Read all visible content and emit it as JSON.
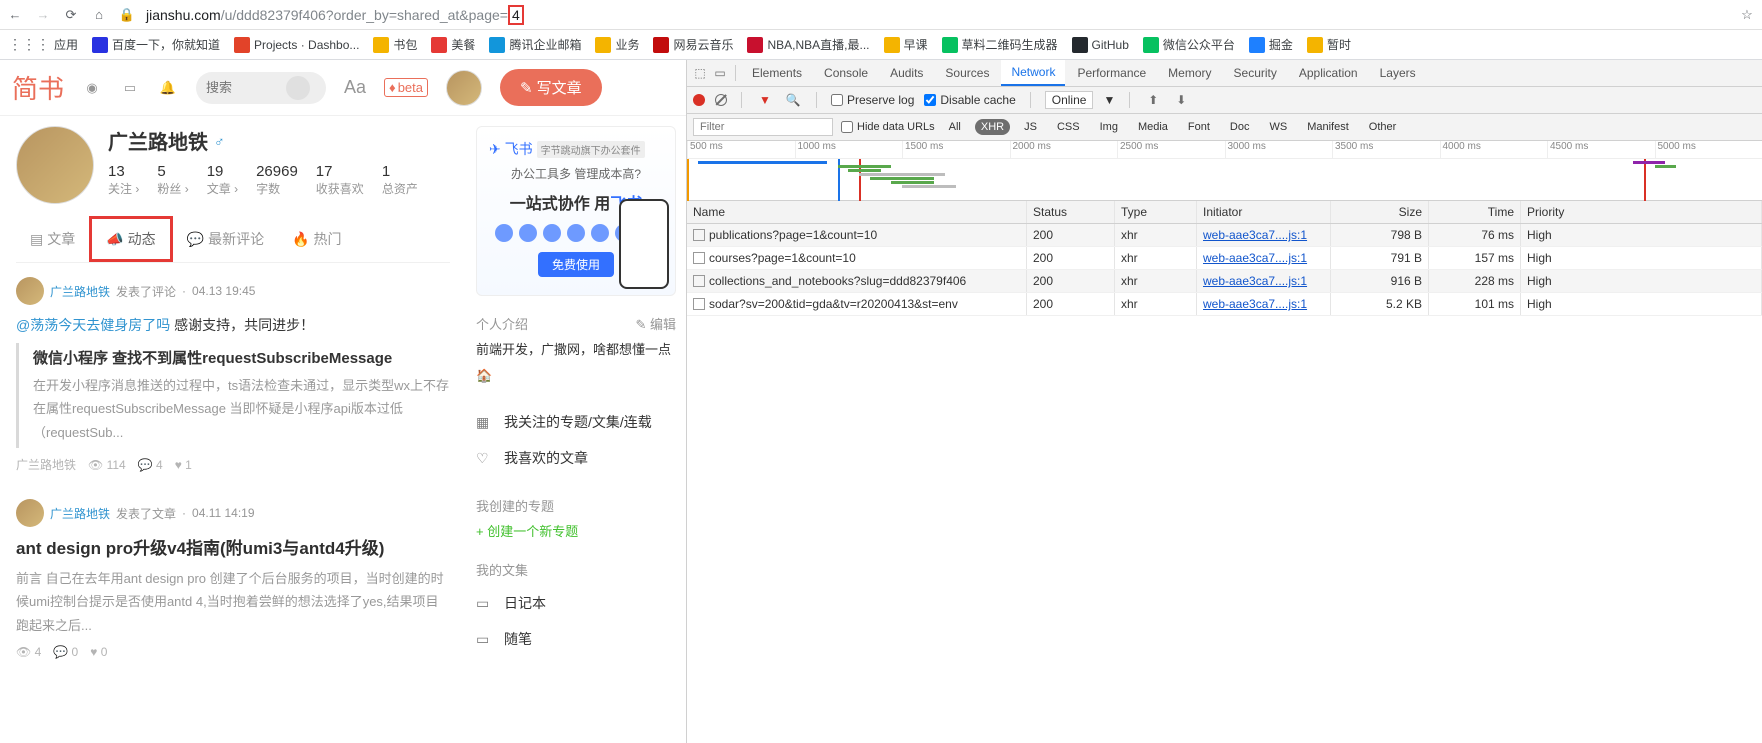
{
  "browser": {
    "url_host": "jianshu.com",
    "url_path": "/u/ddd82379f406?order_by=shared_at&page=",
    "url_highlight": "4"
  },
  "bookmarks": [
    {
      "label": "应用",
      "color": "#5f6368"
    },
    {
      "label": "百度一下，你就知道",
      "color": "#2932e1"
    },
    {
      "label": "Projects · Dashbo...",
      "color": "#e24329"
    },
    {
      "label": "书包",
      "color": "#f4b400"
    },
    {
      "label": "美餐",
      "color": "#e53935"
    },
    {
      "label": "腾讯企业邮箱",
      "color": "#1296db"
    },
    {
      "label": "业务",
      "color": "#f4b400"
    },
    {
      "label": "网易云音乐",
      "color": "#c20c0c"
    },
    {
      "label": "NBA,NBA直播,最...",
      "color": "#c8102e"
    },
    {
      "label": "早课",
      "color": "#f4b400"
    },
    {
      "label": "草料二维码生成器",
      "color": "#07c160"
    },
    {
      "label": "GitHub",
      "color": "#24292e"
    },
    {
      "label": "微信公众平台",
      "color": "#07c160"
    },
    {
      "label": "掘金",
      "color": "#1e80ff"
    },
    {
      "label": "暂时",
      "color": "#f4b400"
    }
  ],
  "jianshu": {
    "logo": "简书",
    "search_placeholder": "搜索",
    "write_label": "写文章",
    "beta": "beta",
    "profile": {
      "name": "广兰路地铁",
      "stats": [
        {
          "num": "13",
          "label": "关注"
        },
        {
          "num": "5",
          "label": "粉丝"
        },
        {
          "num": "19",
          "label": "文章"
        },
        {
          "num": "26969",
          "label": "字数"
        },
        {
          "num": "17",
          "label": "收获喜欢"
        },
        {
          "num": "1",
          "label": "总资产"
        }
      ]
    },
    "tabs": [
      {
        "label": "文章"
      },
      {
        "label": "动态"
      },
      {
        "label": "最新评论"
      },
      {
        "label": "热门"
      }
    ],
    "feed": [
      {
        "author": "广兰路地铁",
        "action": "发表了评论",
        "time": "04.13 19:45",
        "comment_at": "@荡荡今天去健身房了吗",
        "comment_text": " 感谢支持，共同进步！",
        "quote_title": "微信小程序 查找不到属性requestSubscribeMessage",
        "quote_desc": "在开发小程序消息推送的过程中，ts语法检查未通过，显示类型wx上不存在属性requestSubscribeMessage 当即怀疑是小程序api版本过低（requestSub...",
        "meta_author": "广兰路地铁",
        "views": "114",
        "comments": "4",
        "likes": "1"
      },
      {
        "author": "广兰路地铁",
        "action": "发表了文章",
        "time": "04.11 14:19",
        "title": "ant design pro升级v4指南(附umi3与antd4升级)",
        "desc": "前言 自己在去年用ant design pro 创建了个后台服务的项目，当时创建的时候umi控制台提示是否使用antd 4,当时抱着尝鲜的想法选择了yes,结果项目跑起来之后...",
        "views": "4",
        "comments": "0",
        "likes": "0"
      }
    ],
    "sidebar": {
      "ad_small": "办公工具多 管理成本高?",
      "ad_title_1": "一站式协作 用",
      "ad_title_2": "飞书",
      "ad_free": "免费使用",
      "intro_head": "个人介绍",
      "intro_edit": "编辑",
      "intro_text": "前端开发，广撒网，啥都想懂一点",
      "follow_label": "我关注的专题/文集/连载",
      "like_label": "我喜欢的文章",
      "create_head": "我创建的专题",
      "create_add": "+ 创建一个新专题",
      "wenji_head": "我的文集",
      "wenji_items": [
        "日记本",
        "随笔"
      ]
    }
  },
  "devtools": {
    "tabs": [
      "Elements",
      "Console",
      "Audits",
      "Sources",
      "Network",
      "Performance",
      "Memory",
      "Security",
      "Application",
      "Layers"
    ],
    "active_tab": "Network",
    "preserve_log": "Preserve log",
    "disable_cache": "Disable cache",
    "throttle": "Online",
    "filter_placeholder": "Filter",
    "hide_data": "Hide data URLs",
    "filter_tabs": [
      "All",
      "XHR",
      "JS",
      "CSS",
      "Img",
      "Media",
      "Font",
      "Doc",
      "WS",
      "Manifest",
      "Other"
    ],
    "active_filter": "XHR",
    "timeline_ticks": [
      "500 ms",
      "1000 ms",
      "1500 ms",
      "2000 ms",
      "2500 ms",
      "3000 ms",
      "3500 ms",
      "4000 ms",
      "4500 ms",
      "5000 ms"
    ],
    "columns": [
      "Name",
      "Status",
      "Type",
      "Initiator",
      "Size",
      "Time",
      "Priority"
    ],
    "requests": [
      {
        "name": "publications?page=1&count=10",
        "status": "200",
        "type": "xhr",
        "initiator": "web-aae3ca7....js:1",
        "size": "798 B",
        "time": "76 ms",
        "priority": "High"
      },
      {
        "name": "courses?page=1&count=10",
        "status": "200",
        "type": "xhr",
        "initiator": "web-aae3ca7....js:1",
        "size": "791 B",
        "time": "157 ms",
        "priority": "High"
      },
      {
        "name": "collections_and_notebooks?slug=ddd82379f406",
        "status": "200",
        "type": "xhr",
        "initiator": "web-aae3ca7....js:1",
        "size": "916 B",
        "time": "228 ms",
        "priority": "High"
      },
      {
        "name": "sodar?sv=200&tid=gda&tv=r20200413&st=env",
        "status": "200",
        "type": "xhr",
        "initiator": "web-aae3ca7....js:1",
        "size": "5.2 KB",
        "time": "101 ms",
        "priority": "High"
      }
    ]
  }
}
